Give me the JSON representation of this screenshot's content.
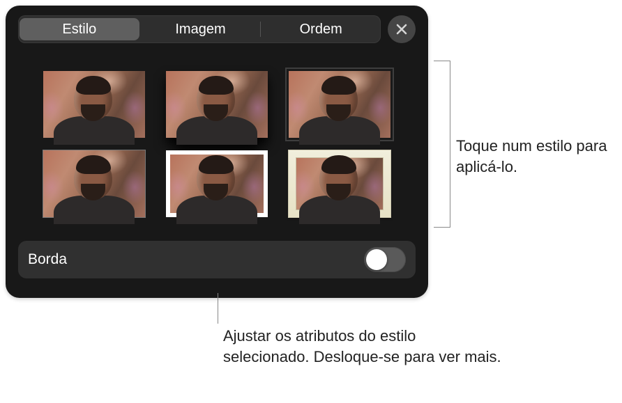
{
  "tabs": {
    "style": "Estilo",
    "image": "Imagem",
    "order": "Ordem"
  },
  "option": {
    "border_label": "Borda",
    "border_on": false
  },
  "callouts": {
    "right": "Toque num estilo para aplicá-lo.",
    "bottom": "Ajustar os atributos do estilo selecionado. Desloque-se para ver mais."
  }
}
